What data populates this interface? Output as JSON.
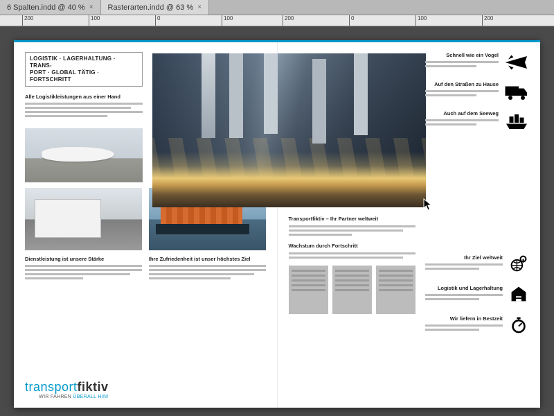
{
  "tabs": [
    {
      "label": "6 Spalten.indd @ 40 %",
      "active": false
    },
    {
      "label": "Rasterarten.indd @ 63 %",
      "active": true
    }
  ],
  "ruler_marks": [
    "200",
    "100",
    "0",
    "100",
    "200",
    "0",
    "100",
    "200"
  ],
  "left": {
    "boxed": "LOGISTIK · LAGERHALTUNG · TRANS-\nPORT · GLOBAL TÄTIG · FORTSCHRITT",
    "h1": "Alle Logistikleistungen aus einer Hand",
    "h2": "Dienstleistung ist unsere Stärke",
    "h3": "Ihre Zufriedenheit ist unser höchstes Ziel",
    "brand1a": "transport",
    "brand1b": "fiktiv",
    "brand2a": "WIR FAHREN ",
    "brand2b": "ÜBERALL HIN!"
  },
  "right_top": [
    {
      "title": "Schnell wie ein Vogel",
      "icon": "plane"
    },
    {
      "title": "Auf den Straßen zu Hause",
      "icon": "truck"
    },
    {
      "title": "Auch auf dem Seeweg",
      "icon": "ship"
    }
  ],
  "mid": {
    "h1": "Transportfiktiv – Ihr Partner weltweit",
    "h2": "Wachstum durch Fortschritt"
  },
  "right_bottom": [
    {
      "title": "Ihr Ziel weltweit",
      "icon": "globe"
    },
    {
      "title": "Logistik und Lagerhaltung",
      "icon": "warehouse"
    },
    {
      "title": "Wir liefern in Bestzeit",
      "icon": "stopwatch"
    }
  ]
}
